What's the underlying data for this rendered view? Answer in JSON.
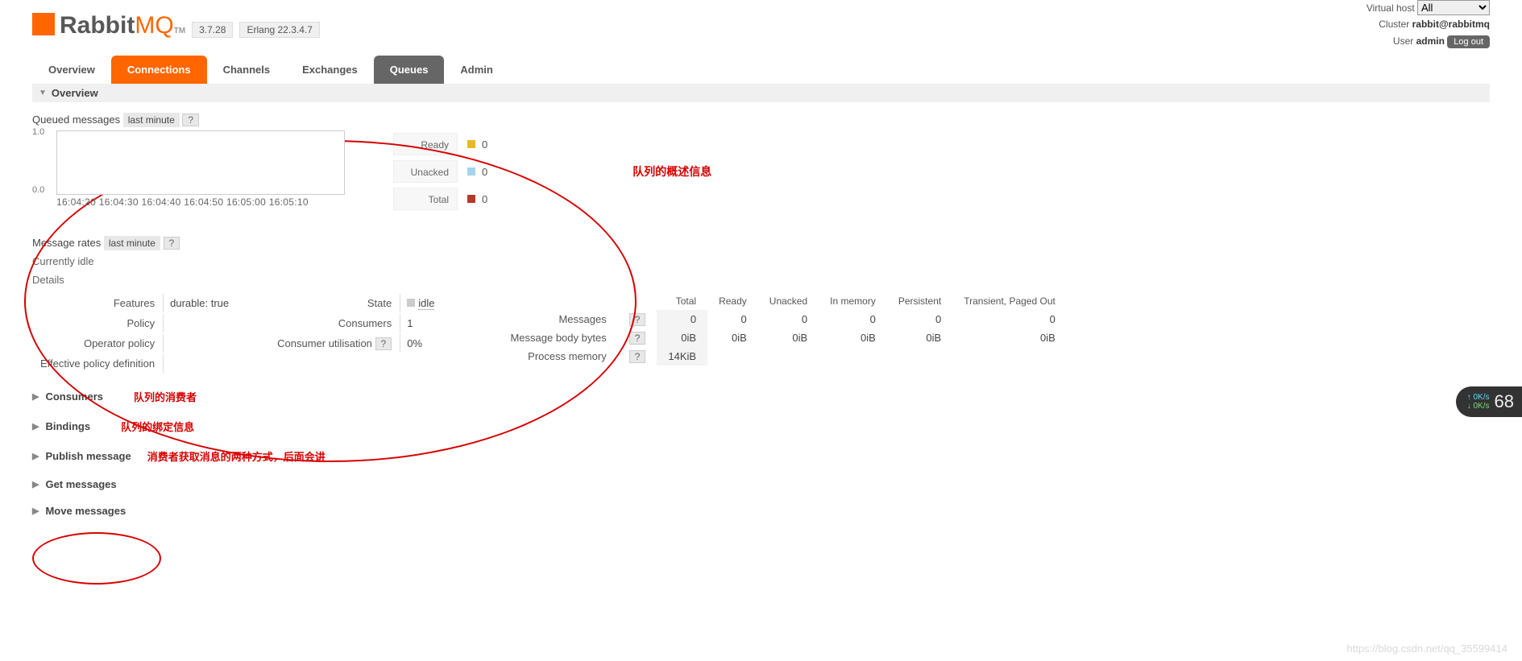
{
  "header": {
    "logo_text": "Rabbit",
    "logo_mq": "MQ",
    "logo_tm": "TM",
    "version": "3.7.28",
    "erlang": "Erlang 22.3.4.7",
    "vhost_label": "Virtual host",
    "vhost_value": "All",
    "cluster_label": "Cluster",
    "cluster_value": "rabbit@rabbitmq",
    "user_label": "User",
    "user_value": "admin",
    "logout": "Log out"
  },
  "tabs": {
    "overview": "Overview",
    "connections": "Connections",
    "channels": "Channels",
    "exchanges": "Exchanges",
    "queues": "Queues",
    "admin": "Admin"
  },
  "section_overview": "Overview",
  "queued": {
    "label": "Queued messages",
    "period": "last minute",
    "help": "?",
    "y_top": "1.0",
    "y_bot": "0.0",
    "x_ticks": "16:04:20 16:04:30 16:04:40 16:04:50 16:05:00 16:05:10",
    "legend": {
      "ready_label": "Ready",
      "ready_val": "0",
      "ready_color": "#e8b923",
      "unacked_label": "Unacked",
      "unacked_val": "0",
      "unacked_color": "#a5d4ec",
      "total_label": "Total",
      "total_val": "0",
      "total_color": "#b63a2a"
    }
  },
  "rates": {
    "label": "Message rates",
    "period": "last minute",
    "help": "?",
    "idle": "Currently idle"
  },
  "details": {
    "title": "Details",
    "features_label": "Features",
    "features_value": "durable: true",
    "policy_label": "Policy",
    "oppolicy_label": "Operator policy",
    "effpolicy_label": "Effective policy definition",
    "state_label": "State",
    "state_value": "idle",
    "consumers_label": "Consumers",
    "consumers_value": "1",
    "cutil_label": "Consumer utilisation",
    "cutil_help": "?",
    "cutil_value": "0%"
  },
  "stats": {
    "cols": {
      "total": "Total",
      "ready": "Ready",
      "unacked": "Unacked",
      "inmem": "In memory",
      "persist": "Persistent",
      "trans": "Transient, Paged Out"
    },
    "rows": {
      "messages": {
        "label": "Messages",
        "help": "?",
        "total": "0",
        "ready": "0",
        "unacked": "0",
        "inmem": "0",
        "persist": "0",
        "trans": "0"
      },
      "mbb": {
        "label": "Message body bytes",
        "help": "?",
        "total": "0iB",
        "ready": "0iB",
        "unacked": "0iB",
        "inmem": "0iB",
        "persist": "0iB",
        "trans": "0iB"
      },
      "pmem": {
        "label": "Process memory",
        "help": "?",
        "total": "14KiB"
      }
    }
  },
  "expanders": {
    "consumers": "Consumers",
    "bindings": "Bindings",
    "publish": "Publish message",
    "get": "Get messages",
    "move": "Move messages"
  },
  "annotations": {
    "overview": "队列的概述信息",
    "consumers": "队列的消费者",
    "bindings": "队列的绑定信息",
    "pubget": "消费者获取消息的两种方式，后面会讲"
  },
  "netwidget": {
    "up": "0K/s",
    "down": "0K/s",
    "big": "68"
  },
  "watermark": "https://blog.csdn.net/qq_35599414",
  "chart_data": {
    "type": "line",
    "title": "Queued messages",
    "categories": [
      "16:04:20",
      "16:04:30",
      "16:04:40",
      "16:04:50",
      "16:05:00",
      "16:05:10"
    ],
    "series": [
      {
        "name": "Ready",
        "values": [
          0,
          0,
          0,
          0,
          0,
          0
        ]
      },
      {
        "name": "Unacked",
        "values": [
          0,
          0,
          0,
          0,
          0,
          0
        ]
      },
      {
        "name": "Total",
        "values": [
          0,
          0,
          0,
          0,
          0,
          0
        ]
      }
    ],
    "ylim": [
      0,
      1
    ],
    "xlabel": "",
    "ylabel": ""
  }
}
